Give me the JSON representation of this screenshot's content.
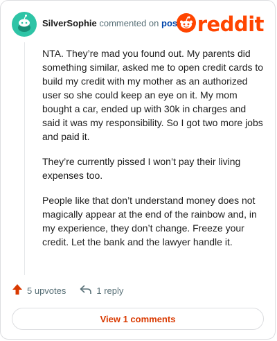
{
  "comment": {
    "username": "SilverSophie",
    "action_text": "commented on",
    "post_link": "post",
    "paragraphs": [
      "NTA. They’re mad you found out. My parents did something similar, asked me to open credit cards to build my credit with my mother as an authorized user so she could keep an eye on it. My mom bought a car, ended up with 30k in charges and said it was my responsibility. So I got two more jobs and paid it.",
      "They’re currently pissed I won’t pay their living expenses too.",
      "People like that don’t understand money does not magically appear at the end of the rainbow and, in my experience, they don’t change. Freeze your credit. Let the bank and the lawyer handle it."
    ]
  },
  "logo": {
    "wordmark": "reddit",
    "icon": "reddit-alien-icon"
  },
  "actions": {
    "upvotes": "5 upvotes",
    "replies": "1 reply"
  },
  "footer": {
    "view_comments": "View 1 comments"
  },
  "colors": {
    "brand": "#ff4500",
    "avatar": "#2ec4a6",
    "link": "#0045ac",
    "button_text": "#d93900"
  },
  "icons": {
    "avatar": "snoo-avatar-icon",
    "upvote": "upvote-arrow-icon",
    "reply": "reply-arrow-icon"
  }
}
